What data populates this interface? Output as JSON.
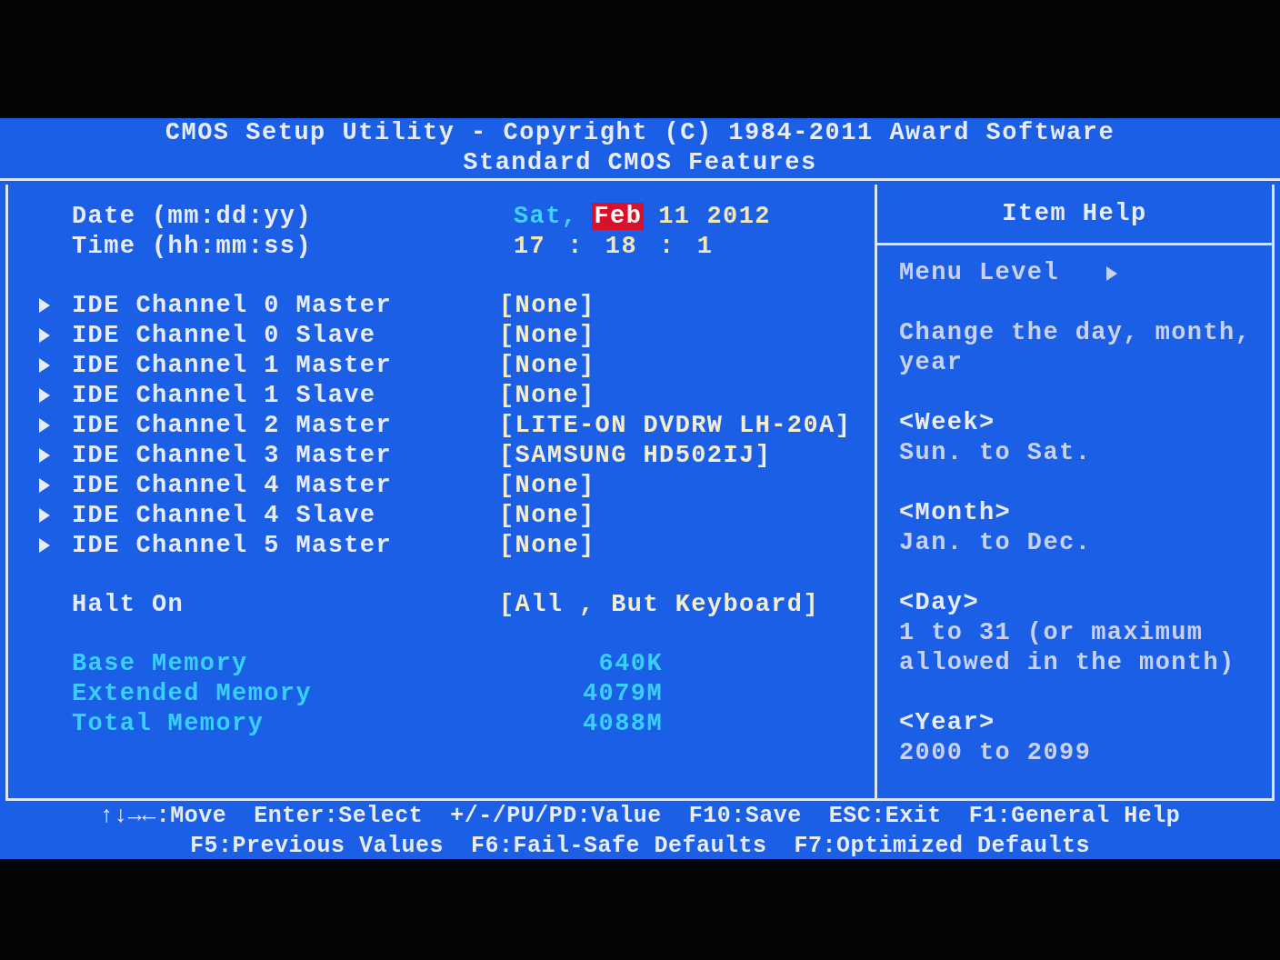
{
  "header": {
    "title": "CMOS Setup Utility - Copyright (C) 1984-2011 Award Software",
    "subtitle": "Standard CMOS Features"
  },
  "date": {
    "label": "Date (mm:dd:yy)",
    "parts": [
      {
        "text": "Sat,",
        "kind": "weekday",
        "selected": false
      },
      {
        "text": "Feb",
        "kind": "value",
        "selected": true
      },
      {
        "text": "11",
        "kind": "value",
        "selected": false
      },
      {
        "text": "2012",
        "kind": "value",
        "selected": false
      }
    ]
  },
  "time": {
    "label": "Time (hh:mm:ss)",
    "parts": [
      {
        "text": "17",
        "kind": "value",
        "selected": false
      },
      {
        "text": ":",
        "kind": "separator"
      },
      {
        "text": "18",
        "kind": "value",
        "selected": false
      },
      {
        "text": ":",
        "kind": "separator"
      },
      {
        "text": "1",
        "kind": "value",
        "selected": false
      }
    ]
  },
  "items": [
    {
      "label": "IDE Channel 0 Master",
      "value": "[None]",
      "submenu": true
    },
    {
      "label": "IDE Channel 0 Slave",
      "value": "[None]",
      "submenu": true
    },
    {
      "label": "IDE Channel 1 Master",
      "value": "[None]",
      "submenu": true
    },
    {
      "label": "IDE Channel 1 Slave",
      "value": "[None]",
      "submenu": true
    },
    {
      "label": "IDE Channel 2 Master",
      "value": "[LITE-ON DVDRW LH-20A]",
      "submenu": true
    },
    {
      "label": "IDE Channel 3 Master",
      "value": "[SAMSUNG HD502IJ]",
      "submenu": true
    },
    {
      "label": "IDE Channel 4 Master",
      "value": "[None]",
      "submenu": true
    },
    {
      "label": "IDE Channel 4 Slave",
      "value": "[None]",
      "submenu": true
    },
    {
      "label": "IDE Channel 5 Master",
      "value": "[None]",
      "submenu": true
    }
  ],
  "halt_on": {
    "label": "Halt On",
    "value": "[All , But Keyboard]",
    "submenu": false
  },
  "memory": [
    {
      "label": "Base Memory",
      "value": "640K"
    },
    {
      "label": "Extended Memory",
      "value": "4079M"
    },
    {
      "label": "Total Memory",
      "value": "4088M"
    }
  ],
  "help": {
    "title": "Item Help",
    "menu_level": "Menu Level",
    "paragraphs": [
      {
        "text": "Change the day, month, year"
      },
      {
        "heading": "<Week>",
        "text": "Sun. to Sat."
      },
      {
        "heading": "<Month>",
        "text": "Jan. to Dec."
      },
      {
        "heading": "<Day>",
        "text": "1 to 31 (or maximum allowed in the month)"
      },
      {
        "heading": "<Year>",
        "text": "2000 to 2099"
      }
    ]
  },
  "footer": [
    [
      "↑↓→←:Move",
      "Enter:Select",
      "+/-/PU/PD:Value",
      "F10:Save",
      "ESC:Exit",
      "F1:General Help"
    ],
    [
      "F5:Previous Values",
      "F6:Fail-Safe Defaults",
      "F7:Optimized Defaults"
    ]
  ]
}
